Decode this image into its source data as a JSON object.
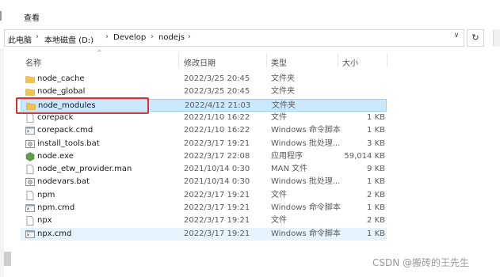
{
  "ribbon": {
    "tab_view": "查看"
  },
  "breadcrumb": [
    "此电脑",
    "本地磁盘 (D:)",
    "Develop",
    "nodejs"
  ],
  "columns": {
    "name": "名称",
    "date": "修改日期",
    "type": "类型",
    "size": "大小"
  },
  "files": [
    {
      "name": "node_cache",
      "date": "2022/3/25 20:45",
      "type": "文件夹",
      "size": "",
      "icon": "folder-icon"
    },
    {
      "name": "node_global",
      "date": "2022/3/25 20:45",
      "type": "文件夹",
      "size": "",
      "icon": "folder-icon"
    },
    {
      "name": "node_modules",
      "date": "2022/4/12 21:03",
      "type": "文件夹",
      "size": "",
      "icon": "folder-icon"
    },
    {
      "name": "corepack",
      "date": "2022/1/10 16:22",
      "type": "文件",
      "size": "1 KB",
      "icon": "file-icon"
    },
    {
      "name": "corepack.cmd",
      "date": "2022/1/10 16:22",
      "type": "Windows 命令脚本",
      "size": "1 KB",
      "icon": "cmd-file-icon"
    },
    {
      "name": "install_tools.bat",
      "date": "2022/3/17 19:21",
      "type": "Windows 批处理...",
      "size": "3 KB",
      "icon": "bat-file-icon"
    },
    {
      "name": "node.exe",
      "date": "2022/3/17 22:08",
      "type": "应用程序",
      "size": "59,014 KB",
      "icon": "node-exe-icon"
    },
    {
      "name": "node_etw_provider.man",
      "date": "2021/10/14 0:30",
      "type": "MAN 文件",
      "size": "9 KB",
      "icon": "file-icon"
    },
    {
      "name": "nodevars.bat",
      "date": "2021/10/14 0:30",
      "type": "Windows 批处理...",
      "size": "1 KB",
      "icon": "bat-file-icon"
    },
    {
      "name": "npm",
      "date": "2022/3/17 19:21",
      "type": "文件",
      "size": "2 KB",
      "icon": "file-icon"
    },
    {
      "name": "npm.cmd",
      "date": "2022/3/17 19:21",
      "type": "Windows 命令脚本",
      "size": "1 KB",
      "icon": "cmd-file-icon"
    },
    {
      "name": "npx",
      "date": "2022/3/17 19:21",
      "type": "文件",
      "size": "2 KB",
      "icon": "file-icon"
    },
    {
      "name": "npx.cmd",
      "date": "2022/3/17 19:21",
      "type": "Windows 命令脚本",
      "size": "1 KB",
      "icon": "cmd-file-icon"
    }
  ],
  "selected_index": 2,
  "hovered_index": 12,
  "watermark": "CSDN @搬砖的王先生",
  "colors": {
    "selection": "#cce8ff",
    "hover": "#e5f3ff",
    "highlight_box": "#e52b2b",
    "folder": "#f2c14e"
  }
}
